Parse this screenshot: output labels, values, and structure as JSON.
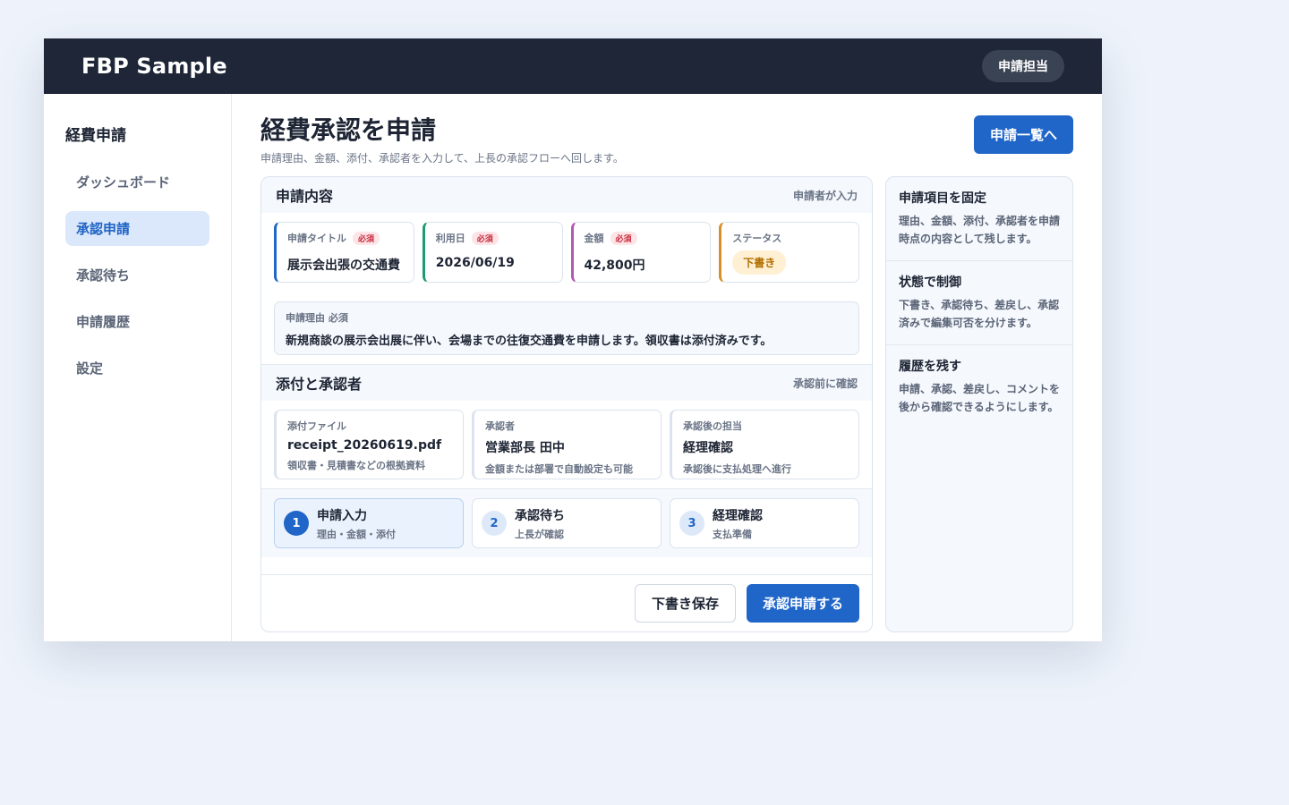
{
  "header": {
    "brand": "FBP Sample",
    "role": "申請担当"
  },
  "sidebar": {
    "title": "経費申請",
    "items": [
      {
        "label": "ダッシュボード",
        "active": false
      },
      {
        "label": "承認申請",
        "active": true
      },
      {
        "label": "承認待ち",
        "active": false
      },
      {
        "label": "申請履歴",
        "active": false
      },
      {
        "label": "設定",
        "active": false
      }
    ]
  },
  "page": {
    "title": "経費承認を申請",
    "subtitle": "申請理由、金額、添付、承認者を入力して、上長の承認フローへ回します。",
    "list_button": "申請一覧へ"
  },
  "request": {
    "section_title": "申請内容",
    "section_note": "申請者が入力",
    "required_label": "必須",
    "fields": {
      "title": {
        "label": "申請タイトル",
        "value": "展示会出張の交通費"
      },
      "date": {
        "label": "利用日",
        "value": "2026/06/19"
      },
      "amount": {
        "label": "金額",
        "value": "42,800円"
      },
      "status": {
        "label": "ステータス",
        "value": "下書き"
      }
    },
    "reason": {
      "label": "申請理由 必須",
      "value": "新規商談の展示会出展に伴い、会場までの往復交通費を申請します。領収書は添付済みです。"
    }
  },
  "attachments": {
    "section_title": "添付と承認者",
    "section_note": "承認前に確認",
    "items": [
      {
        "label": "添付ファイル",
        "value": "receipt_20260619.pdf",
        "sub": "領収書・見積書などの根拠資料"
      },
      {
        "label": "承認者",
        "value": "営業部長 田中",
        "sub": "金額または部署で自動設定も可能"
      },
      {
        "label": "承認後の担当",
        "value": "経理確認",
        "sub": "承認後に支払処理へ進行"
      }
    ]
  },
  "steps": [
    {
      "num": "1",
      "title": "申請入力",
      "sub": "理由・金額・添付",
      "active": true
    },
    {
      "num": "2",
      "title": "承認待ち",
      "sub": "上長が確認",
      "active": false
    },
    {
      "num": "3",
      "title": "経理確認",
      "sub": "支払準備",
      "active": false
    }
  ],
  "actions": {
    "save_draft": "下書き保存",
    "submit": "承認申請する"
  },
  "info": [
    {
      "title": "申請項目を固定",
      "text": "理由、金額、添付、承認者を申請時点の内容として残します。"
    },
    {
      "title": "状態で制御",
      "text": "下書き、承認待ち、差戻し、承認済みで編集可否を分けます。"
    },
    {
      "title": "履歴を残す",
      "text": "申請、承認、差戻し、コメントを後から確認できるようにします。"
    }
  ]
}
